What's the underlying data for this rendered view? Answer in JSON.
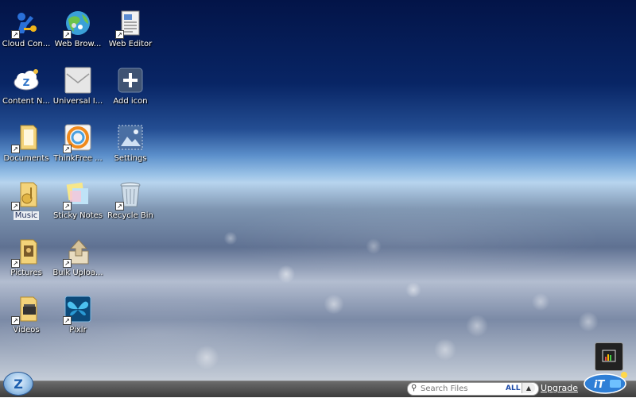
{
  "desktop": {
    "icons": [
      {
        "label": "Cloud Con...",
        "icon": "cloud-connect-key-icon",
        "shortcut": true
      },
      {
        "label": "Web Brow...",
        "icon": "web-browser-globe-icon",
        "shortcut": true
      },
      {
        "label": "Web Editor",
        "icon": "web-editor-document-icon",
        "shortcut": true
      },
      {
        "label": "Content N...",
        "icon": "content-network-cloud-icon",
        "shortcut": false
      },
      {
        "label": "Universal I...",
        "icon": "universal-inbox-envelope-icon",
        "shortcut": false
      },
      {
        "label": "Add icon",
        "icon": "plus-icon",
        "shortcut": false
      },
      {
        "label": "Documents",
        "icon": "documents-folder-icon",
        "shortcut": true
      },
      {
        "label": "ThinkFree ...",
        "icon": "thinkfree-office-icon",
        "shortcut": true
      },
      {
        "label": "Settings",
        "icon": "settings-picture-icon",
        "shortcut": false
      },
      {
        "label": "Music",
        "icon": "music-folder-icon",
        "shortcut": true,
        "selected": true
      },
      {
        "label": "Sticky Notes",
        "icon": "sticky-notes-icon",
        "shortcut": true
      },
      {
        "label": "Recycle Bin",
        "icon": "recycle-bin-icon",
        "shortcut": true
      },
      {
        "label": "Pictures",
        "icon": "pictures-folder-icon",
        "shortcut": true
      },
      {
        "label": "Bulk Uploa...",
        "icon": "bulk-upload-icon",
        "shortcut": true
      },
      {
        "label": "Videos",
        "icon": "videos-folder-icon",
        "shortcut": true
      },
      {
        "label": "Pixlr",
        "icon": "pixlr-butterfly-icon",
        "shortcut": true
      }
    ]
  },
  "taskbar": {
    "search_placeholder": "Search Files",
    "search_scope": "ALL",
    "upgrade_label": "Upgrade"
  }
}
